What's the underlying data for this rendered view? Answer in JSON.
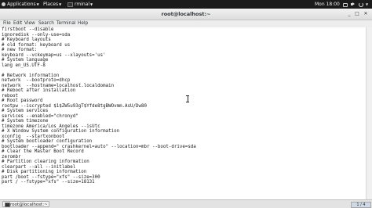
{
  "topbar": {
    "applications": "Applications",
    "places": "Places",
    "app_name": "rminal",
    "clock": "Mon 18:00"
  },
  "window": {
    "title": "root@localhost:~",
    "minimize": "_",
    "maximize": "□",
    "close": "✕"
  },
  "menu": [
    "File",
    "Edit",
    "View",
    "Search",
    "Terminal",
    "Help"
  ],
  "terminal_lines": [
    "firstboot --disable",
    "ignoredisk --only-use=sda",
    "# Keyboard layouts",
    "# old format: keyboard us",
    "# new format:",
    "keyboard --vckeymap=us --xlayouts='us'",
    "# System language",
    "lang en_US.UTF-8",
    "",
    "# Network information",
    "network  --bootproto=dhcp",
    "network  --hostname=localhost.localdomain",
    "# Reboot after installation",
    "reboot",
    "# Root password",
    "rootpw --iscrypted $1$ZW5u93gT$Yfde8tgBWOvmm.AsU/Dw80",
    "# System services",
    "services --enabled=\"chronyd\"",
    "# System timezone",
    "timezone America/Los_Angeles --isUtc",
    "# X Window System configuration information",
    "xconfig  --startxonboot",
    "# System bootloader configuration",
    "bootloader --append=\" crashkernel=auto\" --location=mbr --boot-drive=sda",
    "# Clear the Master Boot Record",
    "zerombr",
    "# Partition clearing information",
    "clearpart --all --initlabel",
    "# Disk partitioning information",
    "part /boot --fstype=\"xfs\" --size=300",
    "part / --fstype=\"xfs\" --size=18131"
  ],
  "taskbar": {
    "task_label": "root@localhost:~",
    "workspace": "1 / 4"
  },
  "colors": {
    "topbar_bg": "#1b1b1b",
    "terminal_bg": "#ffffff",
    "terminal_fg": "#1a1a1a"
  }
}
